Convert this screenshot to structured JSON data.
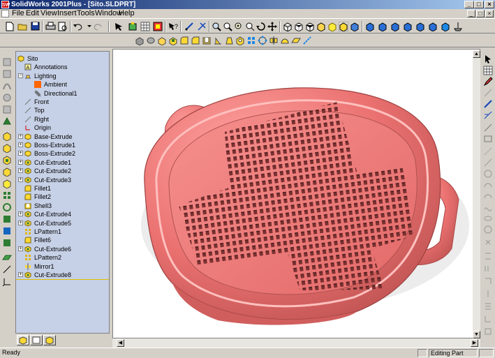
{
  "window": {
    "title": "SolidWorks 2001Plus - [Sito.SLDPRT]",
    "app_icon_text": "SW",
    "controls": [
      "_",
      "□",
      "×"
    ],
    "mdi_controls": [
      "_",
      "□",
      "×"
    ]
  },
  "menu": [
    "File",
    "Edit",
    "View",
    "Insert",
    "Tools",
    "Window",
    "Help"
  ],
  "feature_tree": {
    "items": [
      {
        "label": "Sito",
        "icon": "part-icon",
        "indent": 0,
        "expander": ""
      },
      {
        "label": "Annotations",
        "icon": "annotations-icon",
        "indent": 1,
        "expander": ""
      },
      {
        "label": "Lighting",
        "icon": "lighting-icon",
        "indent": 1,
        "expander": "−"
      },
      {
        "label": "Ambient",
        "icon": "ambient-light-icon",
        "indent": 2,
        "expander": ""
      },
      {
        "label": "Directional1",
        "icon": "directional-light-icon",
        "indent": 2,
        "expander": ""
      },
      {
        "label": "Front",
        "icon": "plane-icon",
        "indent": 1,
        "expander": ""
      },
      {
        "label": "Top",
        "icon": "plane-icon",
        "indent": 1,
        "expander": ""
      },
      {
        "label": "Right",
        "icon": "plane-icon",
        "indent": 1,
        "expander": ""
      },
      {
        "label": "Origin",
        "icon": "origin-icon",
        "indent": 1,
        "expander": ""
      },
      {
        "label": "Base-Extrude",
        "icon": "extrude-icon",
        "indent": 1,
        "expander": "+"
      },
      {
        "label": "Boss-Extrude1",
        "icon": "extrude-icon",
        "indent": 1,
        "expander": "+"
      },
      {
        "label": "Boss-Extrude2",
        "icon": "extrude-icon",
        "indent": 1,
        "expander": "+"
      },
      {
        "label": "Cut-Extrude1",
        "icon": "cut-icon",
        "indent": 1,
        "expander": "+"
      },
      {
        "label": "Cut-Extrude2",
        "icon": "cut-icon",
        "indent": 1,
        "expander": "+"
      },
      {
        "label": "Cut-Extrude3",
        "icon": "cut-icon",
        "indent": 1,
        "expander": "+"
      },
      {
        "label": "Fillet1",
        "icon": "fillet-icon",
        "indent": 1,
        "expander": ""
      },
      {
        "label": "Fillet2",
        "icon": "fillet-icon",
        "indent": 1,
        "expander": ""
      },
      {
        "label": "Shell3",
        "icon": "shell-icon",
        "indent": 1,
        "expander": ""
      },
      {
        "label": "Cut-Extrude4",
        "icon": "cut-icon",
        "indent": 1,
        "expander": "+"
      },
      {
        "label": "Cut-Extrude5",
        "icon": "cut-icon",
        "indent": 1,
        "expander": "+"
      },
      {
        "label": "LPattern1",
        "icon": "pattern-icon",
        "indent": 1,
        "expander": ""
      },
      {
        "label": "Fillet6",
        "icon": "fillet-icon",
        "indent": 1,
        "expander": ""
      },
      {
        "label": "Cut-Extrude6",
        "icon": "cut-icon",
        "indent": 1,
        "expander": "+"
      },
      {
        "label": "LPattern2",
        "icon": "pattern-icon",
        "indent": 1,
        "expander": ""
      },
      {
        "label": "Mirror1",
        "icon": "mirror-icon",
        "indent": 1,
        "expander": ""
      },
      {
        "label": "Cut-Extrude8",
        "icon": "cut-icon",
        "indent": 1,
        "expander": "+"
      }
    ]
  },
  "status": {
    "left": "Ready",
    "right": "Editing Part"
  },
  "colors": {
    "part": "#e8706f",
    "tree_bg": "#c6d0e6",
    "title_start": "#0a246a",
    "title_end": "#a6caf0"
  }
}
